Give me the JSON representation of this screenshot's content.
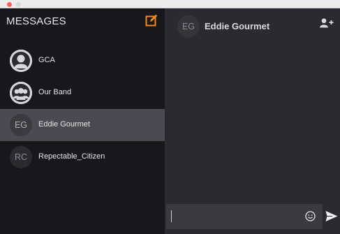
{
  "sidebar": {
    "title": "MESSAGES",
    "compose_icon": "compose-icon",
    "conversations": [
      {
        "name": "GCA",
        "avatar_type": "person-icon",
        "initials": ""
      },
      {
        "name": "Our Band",
        "avatar_type": "group-icon",
        "initials": ""
      },
      {
        "name": "Eddie Gourmet",
        "avatar_type": "initials",
        "initials": "EG",
        "active": true
      },
      {
        "name": "Repectable_Citizen",
        "avatar_type": "initials",
        "initials": "RC"
      }
    ]
  },
  "chat": {
    "initials": "EG",
    "title": "Eddie Gourmet",
    "add_person_icon": "add-person-icon"
  },
  "composer": {
    "value": "",
    "placeholder": "",
    "emoji_icon": "emoji-icon",
    "send_icon": "send-icon"
  },
  "colors": {
    "accent": "#f5891f",
    "sidebar_bg": "#17181b",
    "main_bg": "#2a2b30",
    "active_row": "#4a4a52"
  }
}
